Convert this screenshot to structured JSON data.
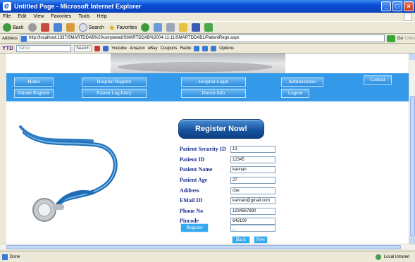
{
  "window": {
    "title": "Untitled Page - Microsoft Internet Explorer"
  },
  "menu": [
    "File",
    "Edit",
    "View",
    "Favorites",
    "Tools",
    "Help"
  ],
  "toolbar": {
    "back": "Back",
    "search": "Search",
    "favorites": "Favorites"
  },
  "address": {
    "label": "Address",
    "url": "http://localhost:1337/SMARTDDAB%20completed/SMARTDDAB%2004-11-11/SMARTDDAB1/PatientRegn.aspx",
    "go": "Go",
    "links": "Links"
  },
  "yahoo": {
    "brand": "YTD",
    "search_placeholder": "Yahoo",
    "search_button": "Search",
    "youtube": "Youtube",
    "amazon": "Amazon",
    "ebay": "eBay",
    "coupons": "Coupons",
    "radio": "Radio",
    "options": "Options"
  },
  "nav": {
    "home": "Home",
    "hospital_register": "Hospital Register",
    "hospital_login": "Hospital Login",
    "administrator": "Administrator",
    "contact": "Contact",
    "patient_register": "Patient Register",
    "patient_log_entry": "Patient Log Entry",
    "doctor_info": "Doctor Info",
    "logout": "Logout"
  },
  "form": {
    "heading": "Register Now!",
    "fields": [
      {
        "label": "Patient Security ID",
        "value": "13"
      },
      {
        "label": "Patient ID",
        "value": "12345"
      },
      {
        "label": "Patient Name",
        "value": "kannan"
      },
      {
        "label": "Patient Age",
        "value": "27"
      },
      {
        "label": "Address",
        "value": "cbe"
      },
      {
        "label": "EMail ID",
        "value": "kannan@gmail.com"
      },
      {
        "label": "Phone No",
        "value": "1234567890"
      },
      {
        "label": "Pincode",
        "value": "642109"
      }
    ],
    "register_button": "Register",
    "extra_value": "_",
    "back_button": "Back",
    "new_button": "New"
  },
  "status": {
    "text": "Done",
    "zone": "Local intranet"
  }
}
